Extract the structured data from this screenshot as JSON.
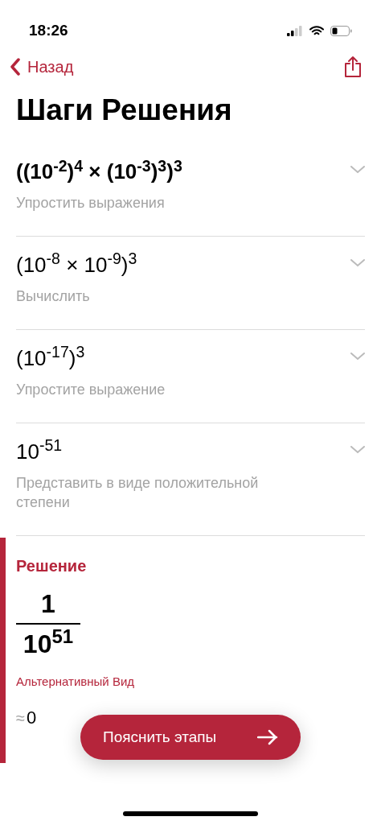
{
  "status_bar": {
    "time": "18:26"
  },
  "nav": {
    "back": "Назад"
  },
  "title": "Шаги Решения",
  "steps": [
    {
      "expression": "((10$^{-2}$)$^{4}$ × (10$^{-3}$)$^{3}$)$^{3}$",
      "bold": true,
      "description": "Упростить выражения"
    },
    {
      "expression": "(10$^{-8}$ × 10$^{-9}$)$^{3}$",
      "bold": false,
      "description": "Вычислить"
    },
    {
      "expression": "(10$^{-17}$)$^{3}$",
      "bold": false,
      "description": "Упростите выражение"
    },
    {
      "expression": "10$^{-51}$",
      "bold": false,
      "description": "Представить в виде положительной степени"
    }
  ],
  "solution": {
    "heading": "Решение",
    "numerator": "1",
    "denominator": "10$^{51}$",
    "alternative_heading": "Альтернативный Вид",
    "approx_sign": "≈",
    "approx_value": "0"
  },
  "explain_button": {
    "label": "Пояснить этапы"
  }
}
